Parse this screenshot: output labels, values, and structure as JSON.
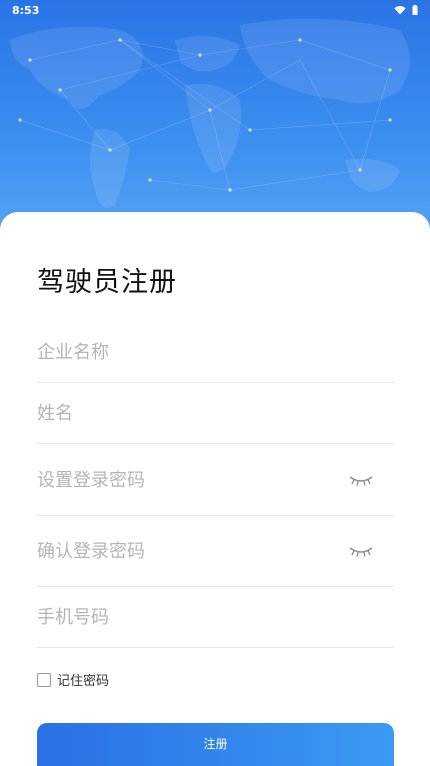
{
  "status_bar": {
    "time": "8:53",
    "wifi_icon": "wifi-icon",
    "battery_icon": "battery-icon"
  },
  "page": {
    "title": "驾驶员注册"
  },
  "form": {
    "company_placeholder": "企业名称",
    "name_placeholder": "姓名",
    "password_placeholder": "设置登录密码",
    "confirm_placeholder": "确认登录密码",
    "phone_placeholder": "手机号码",
    "eye_icon": "eye-closed-icon"
  },
  "remember": {
    "label": "记住密码",
    "checked": false
  },
  "submit": {
    "label": "注册"
  },
  "colors": {
    "accent": "#2f7fe8",
    "accent_light": "#3a9af2"
  }
}
